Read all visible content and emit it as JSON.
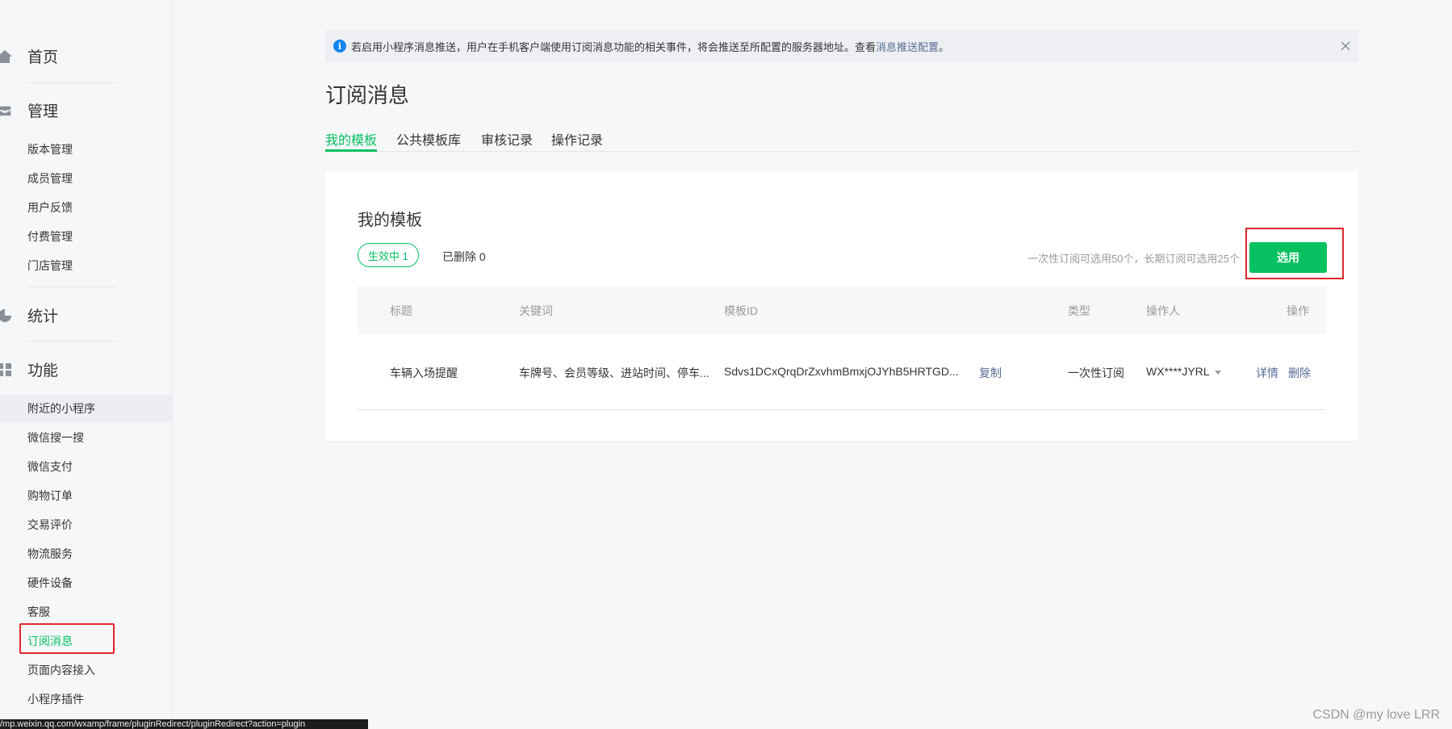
{
  "sidebar": {
    "home": "首页",
    "manage": "管理",
    "manage_items": [
      "版本管理",
      "成员管理",
      "用户反馈",
      "付费管理",
      "门店管理"
    ],
    "stats": "统计",
    "features": "功能",
    "feature_items": [
      "附近的小程序",
      "微信搜一搜",
      "微信支付",
      "购物订单",
      "交易评价",
      "物流服务",
      "硬件设备",
      "客服",
      "订阅消息",
      "页面内容接入",
      "小程序插件"
    ]
  },
  "status_bar_url": "/mp.weixin.qq.com/wxamp/frame/pluginRedirect/pluginRedirect?action=plugin",
  "notice": {
    "text": "若启用小程序消息推送，用户在手机客户端使用订阅消息功能的相关事件，将会推送至所配置的服务器地址。查看",
    "link": "消息推送配置",
    "suffix": "。"
  },
  "page_title": "订阅消息",
  "tabs": [
    "我的模板",
    "公共模板库",
    "审核记录",
    "操作记录"
  ],
  "panel": {
    "title": "我的模板",
    "active_filter": "生效中  1",
    "deleted_filter": "已删除  0",
    "quota_text": "一次性订阅可选用50个，长期订阅可选用25个",
    "select_button": "选用"
  },
  "table": {
    "columns": [
      "标题",
      "关键词",
      "模板ID",
      "类型",
      "操作人",
      "操作"
    ],
    "rows": [
      {
        "title": "车辆入场提醒",
        "keywords": "车牌号、会员等级、进站时间、停车...",
        "template_id": "Sdvs1DCxQrqDrZxvhmBmxjOJYhB5HRTGD...",
        "copy": "复制",
        "type": "一次性订阅",
        "operator": "WX****JYRL",
        "detail": "详情",
        "delete": "删除"
      }
    ]
  },
  "watermark": "CSDN @my love  LRR",
  "colors": {
    "accent": "#07c160",
    "link": "#576b95",
    "highlight_box": "#e0262b",
    "info": "#1485ee"
  }
}
